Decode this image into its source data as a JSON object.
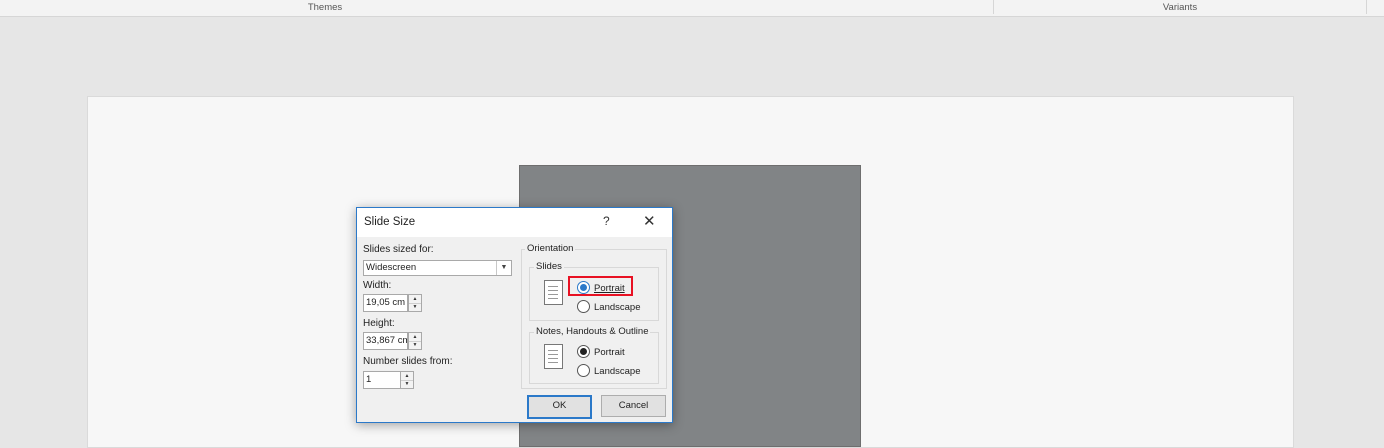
{
  "ribbon": {
    "themes_label": "Themes",
    "variants_label": "Variants"
  },
  "dialog": {
    "title": "Slide Size",
    "help_label": "?",
    "close_label": "✕",
    "slides_sized_for_label": "Slides sized for:",
    "slides_sized_for_value": "Widescreen",
    "width_label": "Width:",
    "width_value": "19,05 cm",
    "height_label": "Height:",
    "height_value": "33,867 cm",
    "number_slides_label": "Number slides from:",
    "number_slides_value": "1",
    "orientation_label": "Orientation",
    "slides_group": {
      "label": "Slides",
      "portrait_label": "Portrait",
      "landscape_label": "Landscape",
      "selected": "Portrait"
    },
    "notes_group": {
      "label": "Notes, Handouts & Outline",
      "portrait_label": "Portrait",
      "landscape_label": "Landscape",
      "selected": "Portrait"
    },
    "ok_label": "OK",
    "cancel_label": "Cancel"
  },
  "icons": {
    "dropdown": "chevron-down-icon",
    "spin_up": "spin-up-icon",
    "spin_down": "spin-down-icon",
    "document": "document-icon"
  },
  "colors": {
    "accent": "#2b79c9",
    "highlight": "#e81123",
    "slide_preview": "#818486"
  }
}
